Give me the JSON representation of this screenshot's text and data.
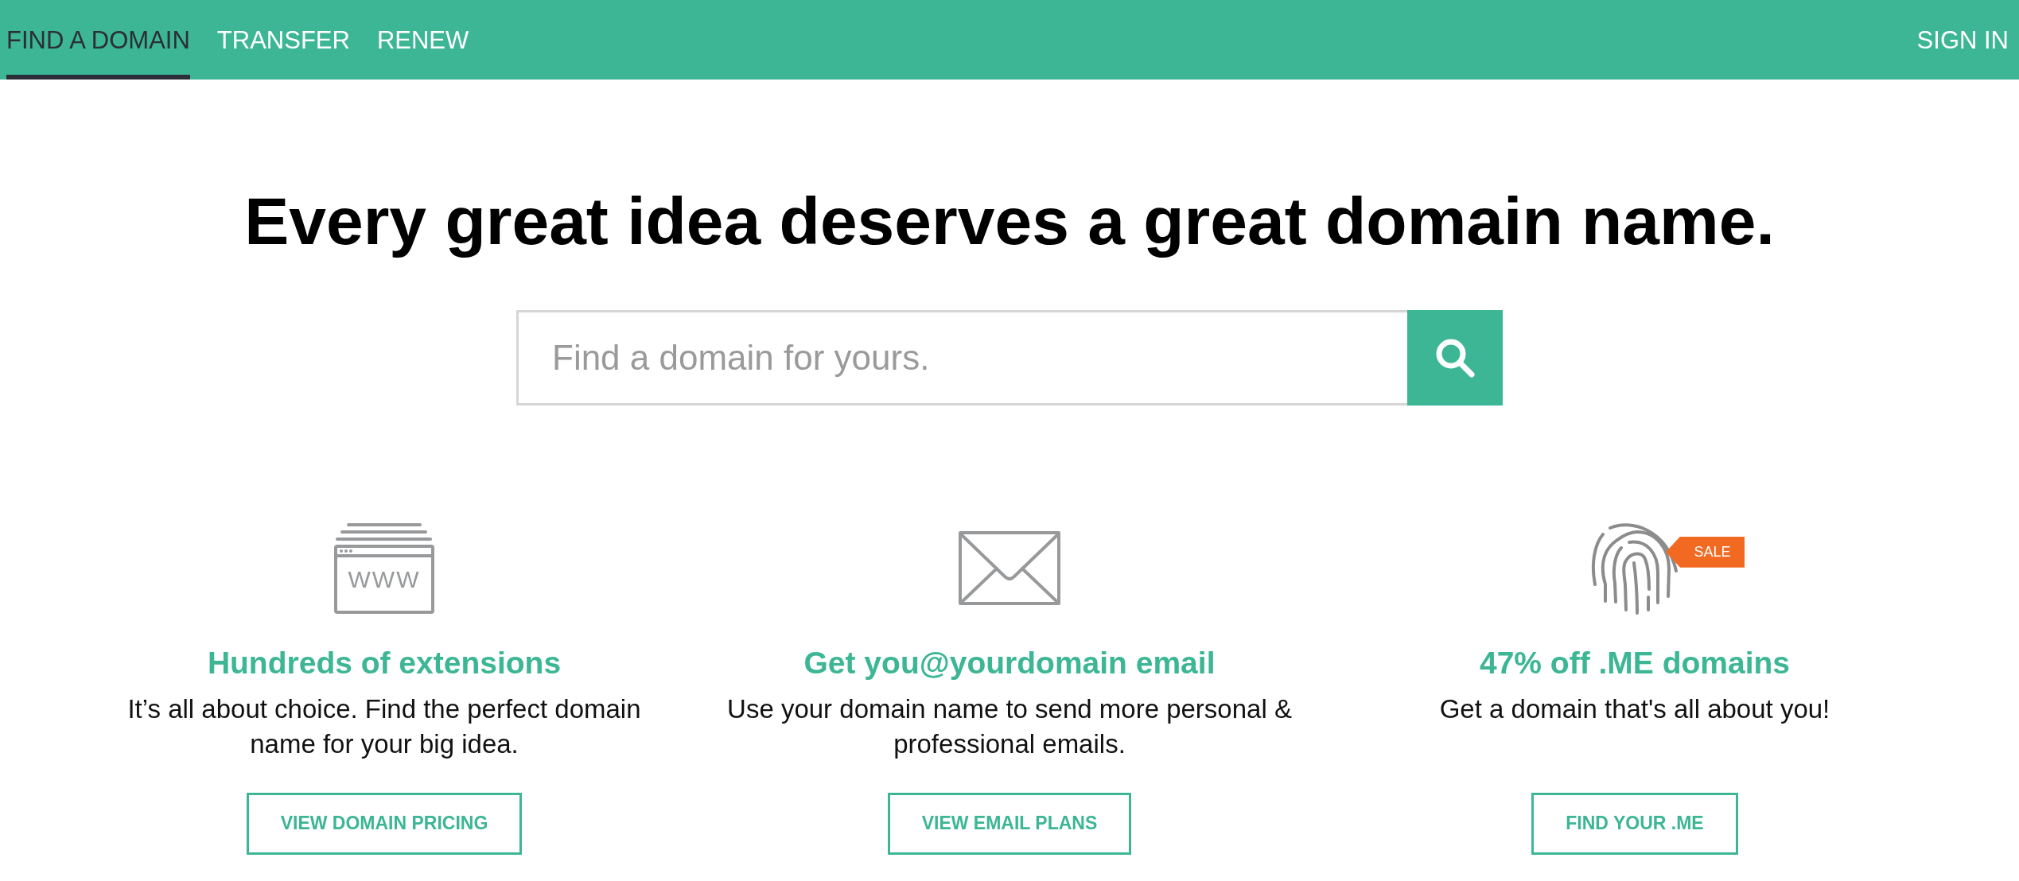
{
  "nav": {
    "tabs": [
      {
        "label": "FIND A DOMAIN",
        "selected": true
      },
      {
        "label": "TRANSFER",
        "selected": false
      },
      {
        "label": "RENEW",
        "selected": false
      }
    ],
    "sign_in": "SIGN IN"
  },
  "hero": {
    "heading": "Every great idea deserves a great domain name.",
    "search": {
      "placeholder": "Find a domain for yours."
    }
  },
  "features": [
    {
      "kind": "extensions",
      "icon_label": "WWW",
      "title": "Hundreds of extensions",
      "text": "It’s all about choice. Find the perfect domain name for your big idea.",
      "button": "VIEW DOMAIN PRICING"
    },
    {
      "kind": "email",
      "title": "Get you@yourdomain email",
      "text": "Use your domain name to send more personal & professional emails.",
      "button": "VIEW EMAIL PLANS"
    },
    {
      "kind": "offer",
      "badge": "SALE",
      "title": "47% off .ME domains",
      "text": "Get a domain that's all about you!",
      "button": "FIND YOUR .ME"
    }
  ]
}
